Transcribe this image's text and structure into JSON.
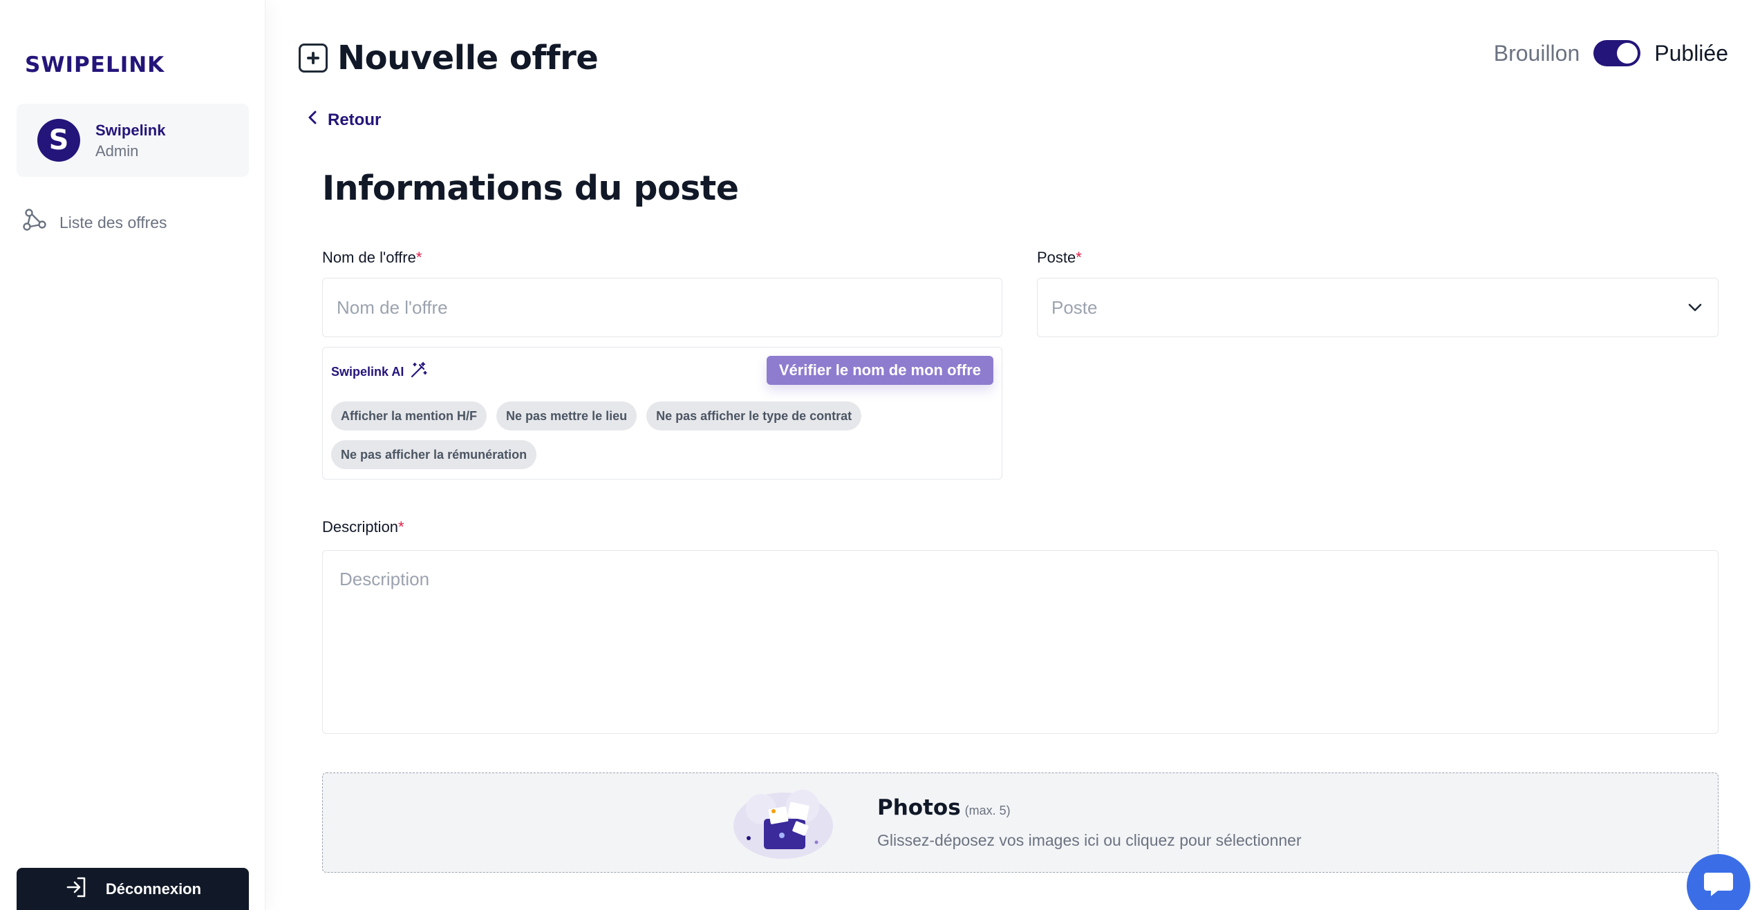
{
  "sidebar": {
    "logo": "SWIPELINK",
    "account": {
      "avatar_letter": "S",
      "name": "Swipelink",
      "role": "Admin"
    },
    "nav": [
      {
        "label": "Liste des offres",
        "icon": "share-nodes-icon"
      }
    ],
    "logout_label": "Déconnexion"
  },
  "header": {
    "title": "Nouvelle offre",
    "status": {
      "draft_label": "Brouillon",
      "published_label": "Publiée",
      "published": true
    }
  },
  "back_label": "Retour",
  "section": {
    "title": "Informations du poste",
    "fields": {
      "offer_name": {
        "label": "Nom de l'offre",
        "required_mark": "*",
        "placeholder": "Nom de l'offre",
        "value": ""
      },
      "position": {
        "label": "Poste",
        "required_mark": "*",
        "placeholder": "Poste",
        "value": ""
      },
      "description": {
        "label": "Description",
        "required_mark": "*",
        "placeholder": "Description",
        "value": ""
      }
    },
    "ai": {
      "label": "Swipelink AI",
      "check_button": "Vérifier le nom de mon offre",
      "chips": [
        "Afficher la mention H/F",
        "Ne pas mettre le lieu",
        "Ne pas afficher le type de contrat",
        "Ne pas afficher la rémunération"
      ]
    },
    "photos": {
      "title": "Photos",
      "max": "(max. 5)",
      "description": "Glissez-déposez vos images ici ou cliquez pour sélectionner"
    }
  },
  "colors": {
    "brand": "#24157a",
    "ai_button": "#8e7ccf",
    "required": "#e11d48",
    "chat": "#3b6ee6",
    "logout_bg": "#111827"
  }
}
